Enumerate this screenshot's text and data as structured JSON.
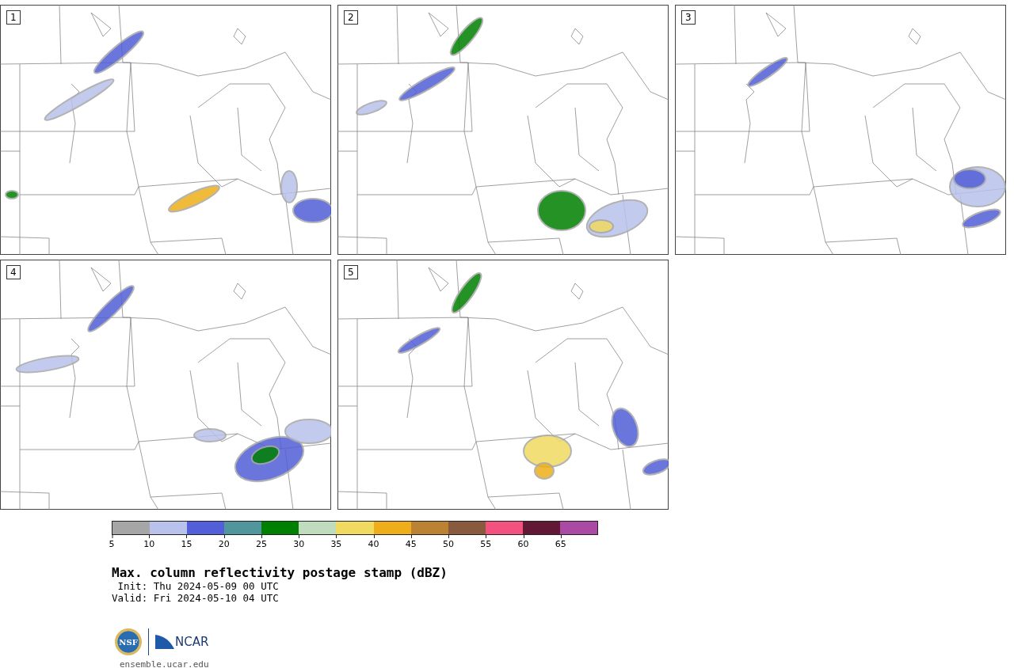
{
  "panels": [
    {
      "number": "1"
    },
    {
      "number": "2"
    },
    {
      "number": "3"
    },
    {
      "number": "4"
    },
    {
      "number": "5"
    }
  ],
  "colorbar": {
    "segments": [
      {
        "color": "#a6a6a6"
      },
      {
        "color": "#b8c2ec"
      },
      {
        "color": "#525fd8"
      },
      {
        "color": "#50969c"
      },
      {
        "color": "#008000"
      },
      {
        "color": "#c0dcbe"
      },
      {
        "color": "#f0da60"
      },
      {
        "color": "#eeae1a"
      },
      {
        "color": "#ba8232"
      },
      {
        "color": "#8a5a3e"
      },
      {
        "color": "#f4527e"
      },
      {
        "color": "#621834"
      },
      {
        "color": "#aa4aa4"
      }
    ],
    "tick_labels": [
      "5",
      "10",
      "15",
      "20",
      "25",
      "30",
      "35",
      "40",
      "45",
      "50",
      "55",
      "60",
      "65"
    ]
  },
  "title": "Max. column reflectivity postage stamp (dBZ)",
  "init": " Init: Thu 2024-05-09 00 UTC",
  "valid": "Valid: Fri 2024-05-10 04 UTC",
  "logos": {
    "nsf": "NSF",
    "ncar": "NCAR"
  },
  "url": "ensemble.ucar.edu"
}
